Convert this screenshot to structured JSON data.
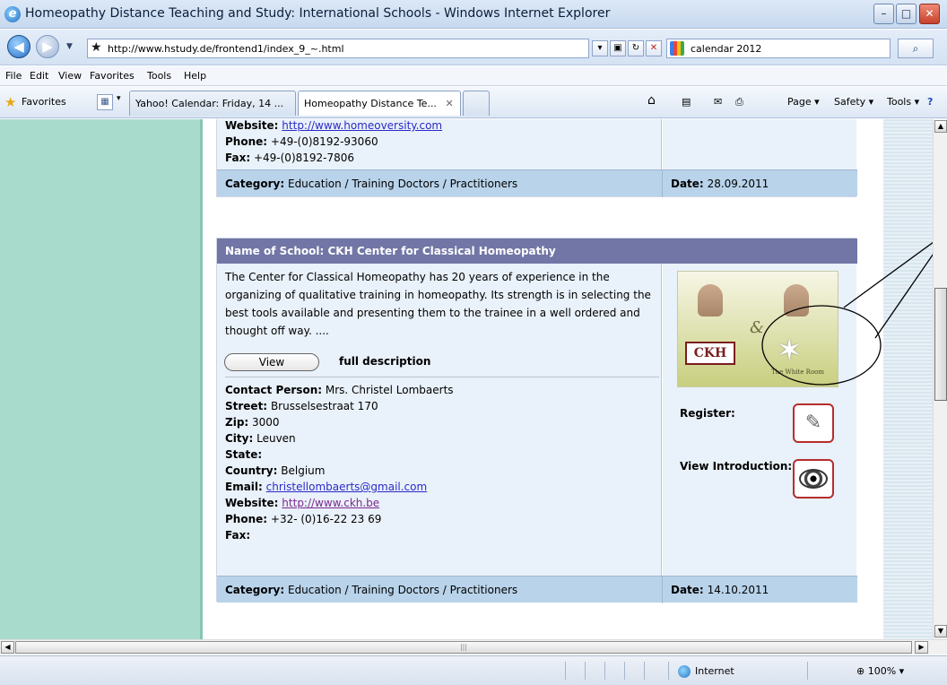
{
  "window": {
    "title": "Homeopathy Distance Teaching and Study: International Schools - Windows Internet Explorer",
    "minimize": "–",
    "maximize": "□",
    "close": "✕"
  },
  "address": {
    "url": "http://www.hstudy.de/frontend1/index_9_~.html",
    "search_text": "calendar 2012"
  },
  "menu": [
    "File",
    "Edit",
    "View",
    "Favorites",
    "Tools",
    "Help"
  ],
  "favorites": {
    "label": "Favorites",
    "tabs": [
      {
        "label": "Yahoo! Calendar: Friday, 14 ..."
      },
      {
        "label": "Homeopathy Distance Te...",
        "close": "✕"
      }
    ],
    "commands": [
      "Page ▾",
      "Safety ▾",
      "Tools ▾"
    ]
  },
  "first_entry": {
    "website_label": "Website:",
    "website": "http://www.homeoversity.com",
    "phone_label": "Phone:",
    "phone": "+49-(0)8192-93060",
    "fax_label": "Fax:",
    "fax": "+49-(0)8192-7806",
    "category_label": "Category:",
    "category": "Education / Training Doctors / Practitioners",
    "date_label": "Date:",
    "date": "28.09.2011"
  },
  "second_entry": {
    "header_label": "Name of School:",
    "school_name": "CKH Center for Classical Homeopathy",
    "description_lines": [
      "The Center for Classical Homeopathy has 20 years of experience in the",
      "organizing of qualitative training in homeopathy. Its strength is in selecting the",
      "best tools available and presenting them to the trainee in a well ordered and",
      "thought off way. ...."
    ],
    "view_button": "View",
    "full_description": "full description",
    "contact_label": "Contact Person:",
    "contact": "Mrs. Christel Lombaerts",
    "street_label": "Street:",
    "street": "Brusselsestraat 170",
    "zip_label": "Zip:",
    "zip": "3000",
    "city_label": "City:",
    "city": "Leuven",
    "state_label": "State:",
    "state": "",
    "country_label": "Country:",
    "country": "Belgium",
    "email_label": "Email:",
    "email": "christellombaerts@gmail.com",
    "website_label": "Website:",
    "website": "http://www.ckh.be",
    "phone_label": "Phone:",
    "phone": "+32- (0)16-22 23 69",
    "fax_label": "Fax:",
    "fax": "",
    "logo_text": "CKH",
    "logo_amp": "&",
    "logo_subtitle": "The White Room",
    "register_label": "Register:",
    "view_intro_label": "View Introduction:",
    "category_label": "Category:",
    "category": "Education / Training Doctors / Practitioners",
    "date_label": "Date:",
    "date": "14.10.2011"
  },
  "status": {
    "zone": "Internet",
    "zoom": "100%"
  },
  "icons": {
    "ie_logo": "e",
    "back": "◀",
    "forward": "▶",
    "star": "★",
    "close_x": "✕",
    "refresh": "↻",
    "compat": "▣",
    "search_go": "⌕",
    "home": "⌂",
    "feeds": "▤",
    "mail": "✉",
    "print": "⎙",
    "help": "?",
    "pen": "✎",
    "scroll_up": "▲",
    "scroll_down": "▼",
    "scroll_left": "◀",
    "scroll_right": "▶"
  }
}
